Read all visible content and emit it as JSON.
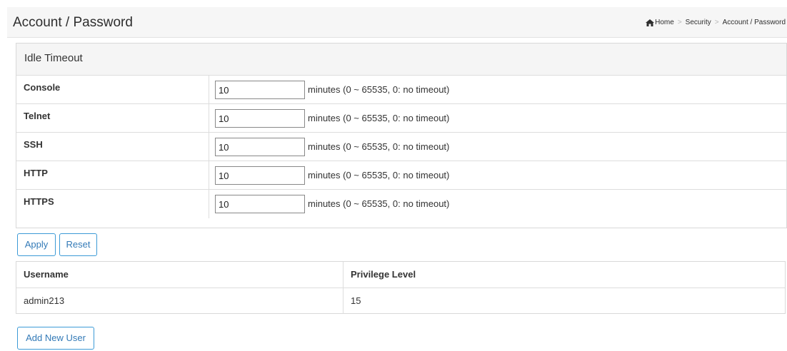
{
  "header": {
    "title": "Account / Password",
    "breadcrumb": [
      {
        "label": "Home",
        "icon": "home-icon"
      },
      {
        "label": "Security"
      },
      {
        "label": "Account / Password"
      }
    ],
    "separator": ">"
  },
  "idle_timeout": {
    "heading": "Idle Timeout",
    "rows": [
      {
        "label": "Console",
        "value": "10",
        "hint": "minutes (0 ~ 65535, 0: no timeout)"
      },
      {
        "label": "Telnet",
        "value": "10",
        "hint": "minutes (0 ~ 65535, 0: no timeout)"
      },
      {
        "label": "SSH",
        "value": "10",
        "hint": "minutes (0 ~ 65535, 0: no timeout)"
      },
      {
        "label": "HTTP",
        "value": "10",
        "hint": "minutes (0 ~ 65535, 0: no timeout)"
      },
      {
        "label": "HTTPS",
        "value": "10",
        "hint": "minutes (0 ~ 65535, 0: no timeout)"
      }
    ]
  },
  "buttons": {
    "apply": "Apply",
    "reset": "Reset",
    "add_user": "Add New User"
  },
  "users": {
    "columns": [
      "Username",
      "Privilege Level"
    ],
    "rows": [
      [
        "admin213",
        "15"
      ]
    ]
  },
  "colors": {
    "button_border": "#3c9ad6",
    "button_text": "#337ab7",
    "header_bg": "#f6f6f6",
    "panel_heading_bg": "#f5f5f5"
  }
}
